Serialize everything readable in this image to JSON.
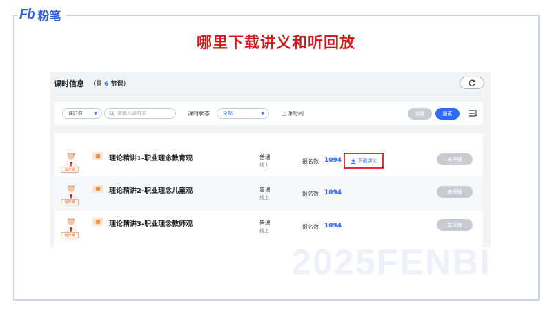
{
  "brand": {
    "mark": "Fb",
    "name": "粉笔",
    "color": "#2f5fe0"
  },
  "slide_title": "哪里下载讲义和听回放",
  "panel": {
    "title": "课时信息",
    "count_prefix": "（共",
    "count": "6",
    "count_suffix": "节课）",
    "refresh_icon": "refresh-icon"
  },
  "filters": {
    "lesson_select": "课时名",
    "search_placeholder": "请输入课时名",
    "status_label": "课时状态",
    "status_value": "全部",
    "time_label": "上课时间",
    "reset_label": "重置",
    "search_label": "搜索"
  },
  "lessons": [
    {
      "tag": "尚开课",
      "title": "理论精讲1-职业理念教育观",
      "type": "普通",
      "mode": "线上",
      "enroll_label": "报名数",
      "enroll_count": "1094",
      "download_label": "下载讲义",
      "status": "未开播"
    },
    {
      "tag": "尚开课",
      "title": "理论精讲2-职业理念儿童观",
      "type": "普通",
      "mode": "线上",
      "enroll_label": "报名数",
      "enroll_count": "1094",
      "download_label": "",
      "status": "未开播"
    },
    {
      "tag": "尚开课",
      "title": "理论精讲3-职业理念教师观",
      "type": "普通",
      "mode": "线上",
      "enroll_label": "报名数",
      "enroll_count": "1094",
      "download_label": "",
      "status": "未开播"
    }
  ],
  "watermark": "2025FENBI",
  "colors": {
    "accent": "#2f6bff",
    "title_red": "#d11a1a",
    "highlight_border": "#e23030"
  }
}
